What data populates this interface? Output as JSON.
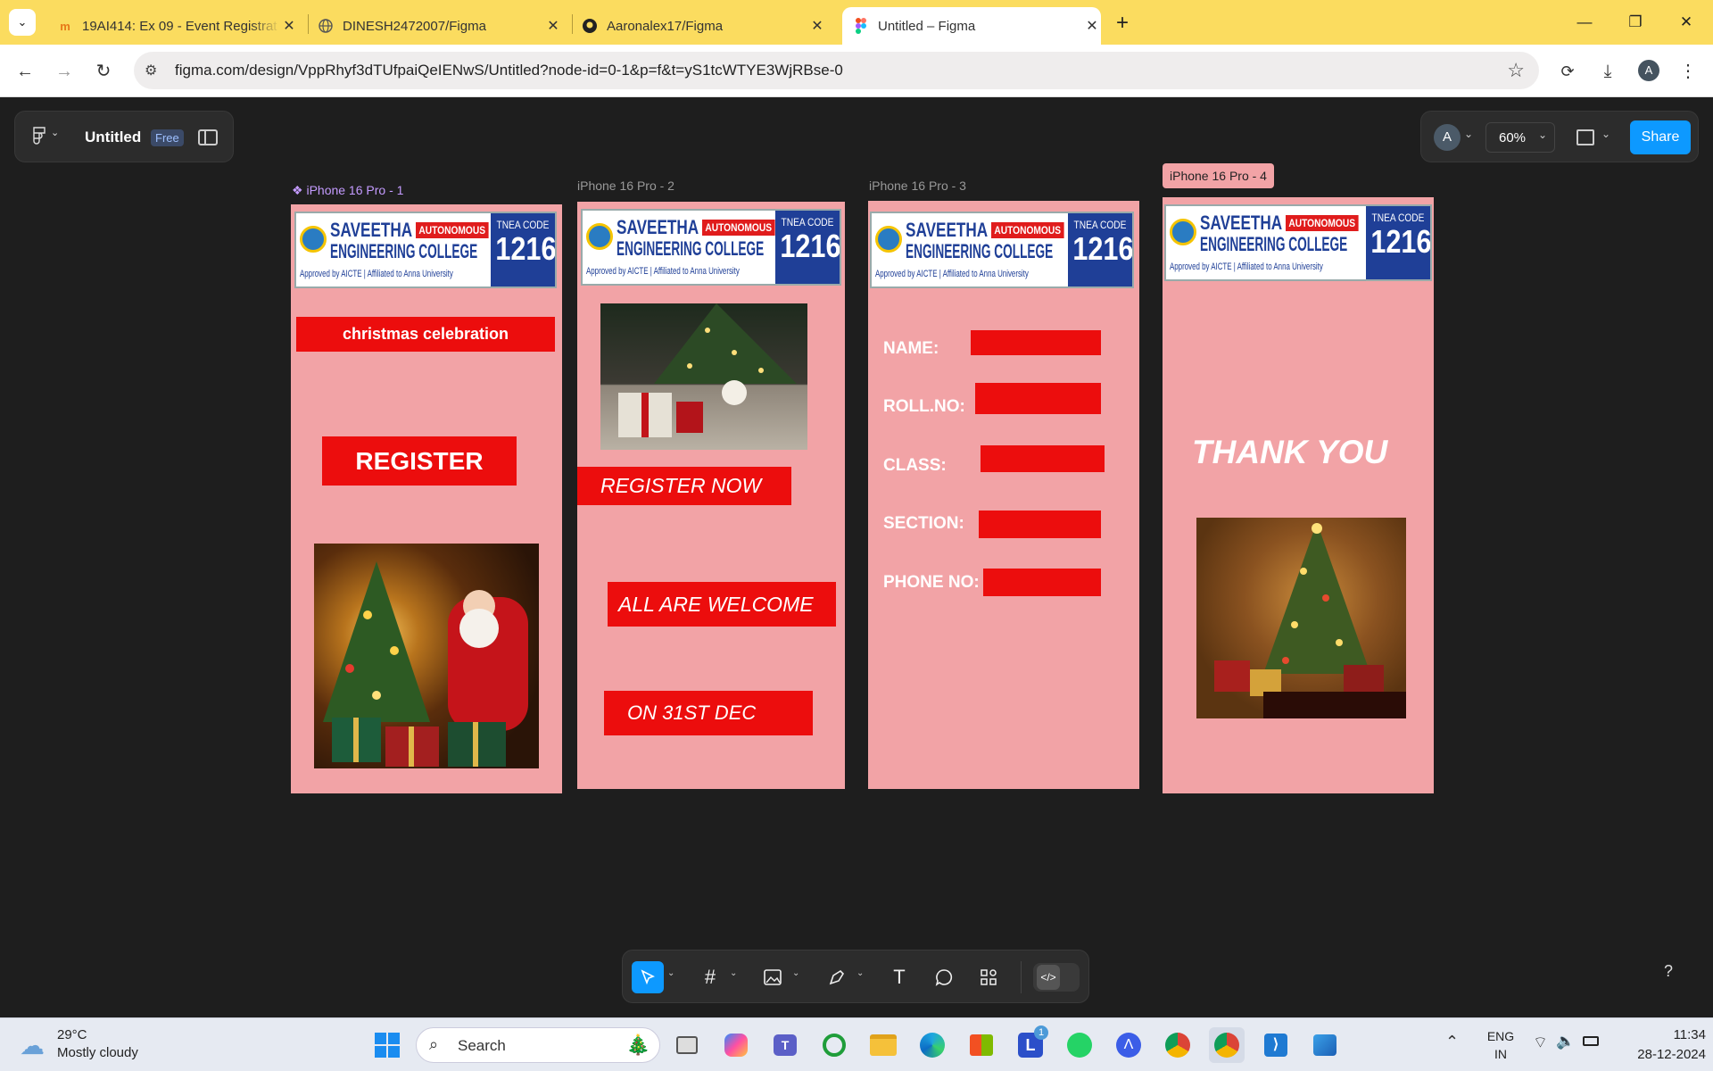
{
  "browser": {
    "tabs": [
      {
        "title": "19AI414: Ex 09 - Event Registrat",
        "favicon": "moodle-icon"
      },
      {
        "title": "DINESH2472007/Figma",
        "favicon": "globe-icon"
      },
      {
        "title": "Aaronalex17/Figma",
        "favicon": "github-icon"
      },
      {
        "title": "Untitled – Figma",
        "favicon": "figma-icon"
      }
    ],
    "url": "figma.com/design/VppRhyf3dTUfpaiQeIENwS/Untitled?node-id=0-1&p=f&t=yS1tcWTYE3WjRBse-0",
    "profile_initial": "A"
  },
  "figma": {
    "file_name": "Untitled",
    "plan_badge": "Free",
    "user_initial": "A",
    "zoom": "60%",
    "share_label": "Share",
    "help_label": "?"
  },
  "frames": [
    {
      "label": "iPhone 16 Pro - 1",
      "heading": "christmas celebration",
      "button": "REGISTER",
      "image": "santa-christmas-photo"
    },
    {
      "label": "iPhone 16 Pro - 2",
      "image": "gifts-under-tree-photo",
      "texts": [
        "REGISTER NOW",
        "ALL ARE WELCOME",
        "ON 31ST DEC"
      ]
    },
    {
      "label": "iPhone 16 Pro - 3",
      "fields": [
        "NAME:",
        "ROLL.NO:",
        "CLASS:",
        "SECTION:",
        "PHONE NO:"
      ]
    },
    {
      "label": "iPhone 16 Pro - 4",
      "heading": "THANK YOU",
      "image": "christmas-tree-photo"
    }
  ],
  "logo": {
    "name_line1": "SAVEETHA",
    "name_line2": "ENGINEERING COLLEGE",
    "autonomous": "AUTONOMOUS",
    "approval": "Approved by AICTE | Affiliated to Anna University",
    "tnea_label": "TNEA CODE",
    "tnea_code": "1216"
  },
  "taskbar": {
    "weather_temp": "29°C",
    "weather_desc": "Mostly cloudy",
    "search_placeholder": "Search",
    "lang_top": "ENG",
    "lang_bottom": "IN",
    "time": "11:34",
    "date": "28-12-2024",
    "notification_count": "1"
  },
  "colors": {
    "tab_strip": "#fbdc5f",
    "canvas": "#1e1e1e",
    "frame_fill": "#f2a3a6",
    "accent_red": "#ec0d0d",
    "share_blue": "#0d99ff"
  }
}
